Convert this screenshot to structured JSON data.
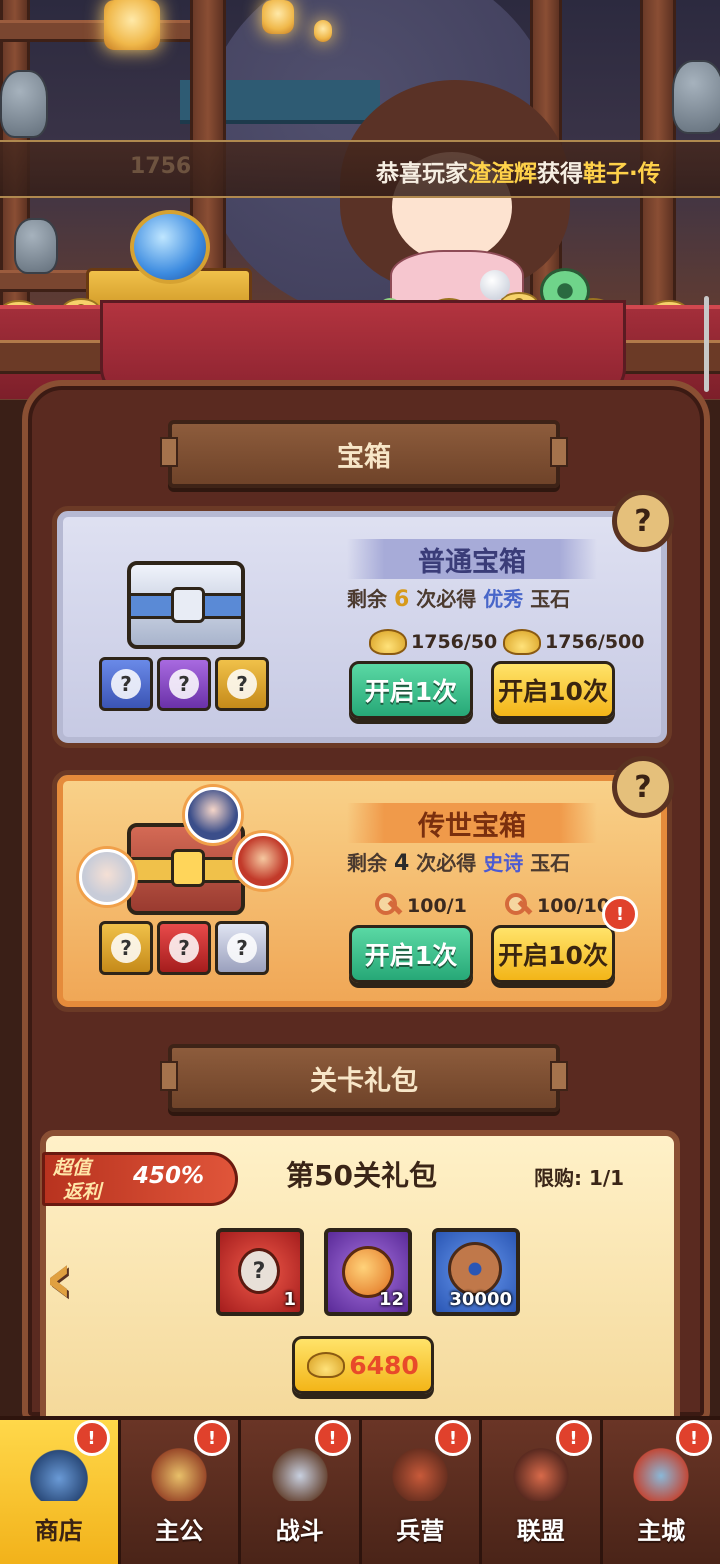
{
  "ticker": {
    "ghost_amount": "1756",
    "prefix": "恭喜玩家",
    "player": "渣渣辉",
    "mid": "获得",
    "item": "鞋子",
    "suffix": "·传"
  },
  "chest_section": {
    "title": "宝箱"
  },
  "normal_chest": {
    "name": "普通宝箱",
    "guarantee_pre": "剩余",
    "guarantee_count": "6",
    "guarantee_mid": "次必得",
    "guarantee_quality": "优秀",
    "guarantee_item": "玉石",
    "cost_1": "1756/50",
    "cost_10": "1756/500",
    "btn_1": "开启1次",
    "btn_10": "开启10次",
    "help": "?"
  },
  "legend_chest": {
    "name": "传世宝箱",
    "guarantee_pre": "剩余",
    "guarantee_count": "4",
    "guarantee_mid": "次必得",
    "guarantee_quality": "史诗",
    "guarantee_item": "玉石",
    "cost_1": "100/1",
    "cost_10": "100/10",
    "btn_1": "开启1次",
    "btn_10": "开启10次",
    "help": "?"
  },
  "stage_section": {
    "title": "关卡礼包"
  },
  "gift_pack": {
    "badge_line1": "超值",
    "badge_line2": "返利",
    "badge_percent": "450%",
    "title": "第50关礼包",
    "limit": "限购: 1/1",
    "rewards": [
      {
        "icon": "red-mystery-jade",
        "count": "1"
      },
      {
        "icon": "purple-dragon-orb",
        "count": "12"
      },
      {
        "icon": "copper-coin",
        "count": "30000"
      }
    ],
    "price": "6480"
  },
  "nav": [
    {
      "label": "商店",
      "active": true,
      "alert": "!"
    },
    {
      "label": "主公",
      "active": false,
      "alert": "!"
    },
    {
      "label": "战斗",
      "active": false,
      "alert": "!"
    },
    {
      "label": "兵营",
      "active": false,
      "alert": "!"
    },
    {
      "label": "联盟",
      "active": false,
      "alert": "!"
    },
    {
      "label": "主城",
      "active": false,
      "alert": "!"
    }
  ]
}
